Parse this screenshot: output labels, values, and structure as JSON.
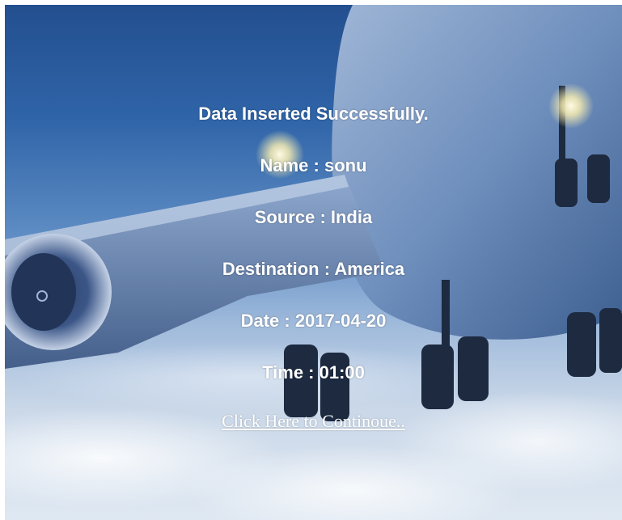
{
  "result": {
    "message": "Data Inserted Successfully.",
    "name_line": "Name : sonu",
    "source_line": "Source : India",
    "destination_line": "Destination : America",
    "date_line": "Date : 2017-04-20",
    "time_line": "Time : 01:00"
  },
  "link": {
    "label": "Click Here to Continoue.."
  },
  "background": {
    "description_icon": "airplane-background-image",
    "colors": {
      "sky_top": "#234f8f",
      "sky_bottom": "#dfe8f2",
      "fuselage": "#8aa6cc",
      "text": "#ffffff"
    }
  }
}
